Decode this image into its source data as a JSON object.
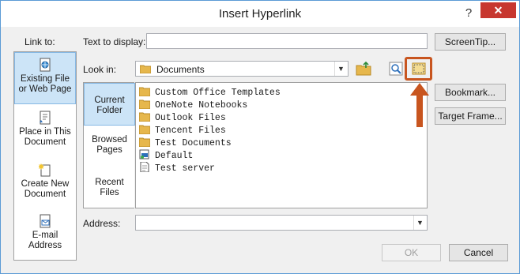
{
  "window": {
    "title": "Insert Hyperlink",
    "help_glyph": "?",
    "close_glyph": "✕"
  },
  "labels": {
    "link_to": "Link to:",
    "text_to_display": "Text to display:",
    "look_in": "Look in:",
    "address": "Address:"
  },
  "fields": {
    "text_to_display_value": "",
    "look_in_value": "Documents",
    "address_value": ""
  },
  "link_to_items": [
    {
      "label_line1": "Existing File",
      "label_line2": "or Web Page",
      "icon": "globe-document-icon",
      "selected": true
    },
    {
      "label_line1": "Place in This",
      "label_line2": "Document",
      "icon": "document-bookmark-icon",
      "selected": false
    },
    {
      "label_line1": "Create New",
      "label_line2": "Document",
      "icon": "new-document-icon",
      "selected": false
    },
    {
      "label_line1": "E-mail",
      "label_line2": "Address",
      "icon": "email-icon",
      "selected": false
    }
  ],
  "location_tabs": [
    {
      "label_line1": "Current",
      "label_line2": "Folder",
      "selected": true
    },
    {
      "label_line1": "Browsed",
      "label_line2": "Pages",
      "selected": false
    },
    {
      "label_line1": "Recent",
      "label_line2": "Files",
      "selected": false
    }
  ],
  "files": [
    {
      "name": "Custom Office Templates",
      "icon": "folder-icon"
    },
    {
      "name": "OneNote Notebooks",
      "icon": "folder-icon"
    },
    {
      "name": "Outlook Files",
      "icon": "folder-icon"
    },
    {
      "name": "Tencent Files",
      "icon": "folder-icon"
    },
    {
      "name": "Test Documents",
      "icon": "folder-icon"
    },
    {
      "name": "Default",
      "icon": "rdp-file-icon"
    },
    {
      "name": "Test server",
      "icon": "document-icon"
    }
  ],
  "buttons": {
    "screentip": "ScreenTip...",
    "bookmark": "Bookmark...",
    "target_frame": "Target Frame...",
    "ok": "OK",
    "cancel": "Cancel"
  },
  "colors": {
    "accent_highlight": "#c8551f",
    "selected_bg": "#cce4f7",
    "close_red": "#c7372f"
  }
}
